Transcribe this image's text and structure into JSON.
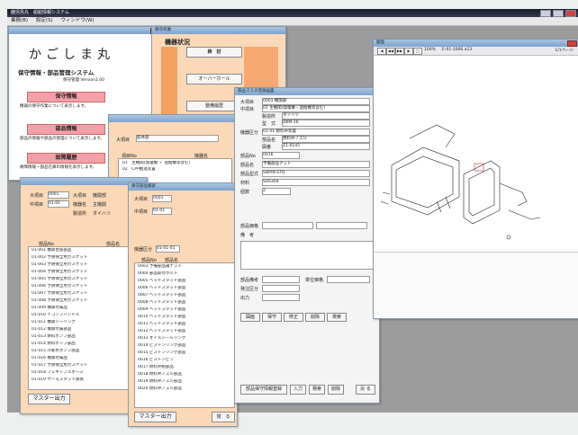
{
  "main_window": {
    "title": "鹿児島丸　船舶情報システム",
    "menu": [
      "業務(B)",
      "設定(S)",
      "ウィンドウ(W)"
    ]
  },
  "w1": {
    "ship_name": "かごしま丸",
    "system_name": "保守情報・部品管理システム",
    "version": "保守管理  Version1.00",
    "btn_maint": "保守情報",
    "btn_parts": "部品情報",
    "btn_hist": "故障履歴",
    "desc_maint": "機器の保守作業について表示します。",
    "desc_parts": "部品の情報や部品の管理について表示します。",
    "desc_hist": "故障情報・部品在庫の情報を表示します。"
  },
  "w2": {
    "title": "保守作業",
    "heading": "機器状況",
    "btn_a": "検　討",
    "btn_b": "オーバーホール",
    "btn_c": "整備履歴"
  },
  "w3": {
    "label_class": "大項目",
    "class_value": "船体部",
    "col1": "項目No",
    "col2": "機器名",
    "rows": [
      {
        "no": "01",
        "name": "主機関(発電機 ・ 過給機等含む)"
      },
      {
        "no": "02",
        "name": "CPP推進装置"
      }
    ]
  },
  "w4": {
    "label1": "大項目",
    "value1": "0001",
    "label2": "大項目",
    "value2": "機関部",
    "label3": "中項目",
    "value3": "01-01",
    "label3b": "機器名",
    "value3b": "主機関",
    "label4": "製造所",
    "value4": "ダイハツ",
    "col_a": "部品No",
    "col_b": "部品名",
    "rows": [
      "01-001 機関台座部品",
      "01-002 予防保全用ガスケット",
      "01-003 予防保全用ガスケット",
      "01-004 予防保全用ガスケット",
      "01-005 予防保全用ガスケット",
      "01-006 予防保全用ガスケット",
      "01-007 予防保全用ガスケット",
      "01-008 予防保全用ガスケット",
      "01-009 機関付属品",
      "01-010 デコンプハンドル",
      "01-011 機関シーリング",
      "01-012 機関付属部品",
      "01-013 燃料ポンプ部品",
      "01-014 燃料ポンプ部品",
      "01-015 冷却水ポンプ部品",
      "01-016 機関付属品",
      "01-017 予防保全用ガスケット",
      "01-018 フレキシブルホース",
      "01-019 サーモスタット関係"
    ],
    "footer_btn": "マスター出力"
  },
  "w5": {
    "title": "保守部品検索",
    "lbl_a": "大項目",
    "val_a": "0001",
    "lbl_b": "中項目",
    "val_b": "01-01",
    "lbl_c": "機器区分",
    "val_c": "01-01-01",
    "col_no": "部品No",
    "col_name": "部品名",
    "rows": [
      "0003 予備部品箱ナット",
      "0004 部品取付ボルト",
      "0005 ヘッドスタッド部品",
      "0006 ヘッドスタッド部品",
      "0007 ヘッドスタッド部品",
      "0008 ヘッドスタッド部品",
      "0009 ヘッドスタッド部品",
      "0010 ヘッドスタッド部品",
      "0011 ヘッドスタッド部品",
      "0012 ヘッドスタッド部品",
      "0013 オイルシールリング",
      "0014 ピストンリング部品",
      "0015 ピストンリング部品",
      "0016 ピストンピン",
      "0017 燃料弁組部品",
      "0018 燃料弁ノズル部品",
      "0019 燃料弁ノズル部品",
      "0020 燃料弁ノズル部品"
    ],
    "footer_btn": "マスター出力",
    "close_btn": "閉　る"
  },
  "w6": {
    "title": "部品マスタ登録画面",
    "fields": [
      [
        "大項目",
        "0001 機関部"
      ],
      [
        "中項目",
        "01 主機関(発電機・過給機等含む)"
      ],
      [
        "製造所",
        "ダイハツ"
      ],
      [
        "型　式",
        "DKM-26"
      ],
      [
        "機器区分",
        "01-01 燃料弁装置"
      ],
      [
        "部品名",
        "燃料弁ノズル"
      ],
      [
        "図番",
        "Z1-0145"
      ],
      [
        "部品No",
        "0016"
      ],
      [
        "部品名",
        "予備部品ナット"
      ],
      [
        "部品型式",
        "SWRN-STD"
      ],
      [
        "材料",
        "SUS304"
      ],
      [
        "個数",
        "2"
      ]
    ],
    "notes": [
      "部品価格",
      "備　考"
    ],
    "bottom": [
      "部品備考",
      "発注区分",
      "出力",
      "単位価格",
      "図面",
      "保守",
      "修正",
      "削除",
      "検索"
    ],
    "footer_buttons": [
      "部品保守情報登録",
      "入力",
      "検索",
      "削除",
      "戻 る"
    ]
  },
  "w7": {
    "title": "図面",
    "page_info": "1/1ページ",
    "toolbar": [
      "◀",
      "◀◀",
      "▶▶",
      "▶",
      "□"
    ],
    "zoom": "100%",
    "file": "E-01-1066.a13"
  }
}
